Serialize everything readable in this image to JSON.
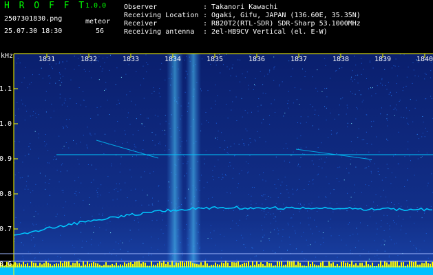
{
  "app": {
    "name": "H R O F F T",
    "version": "1.0.0"
  },
  "file": {
    "name": "2507301830.png",
    "datetime": "25.07.30 18:30"
  },
  "meteor": {
    "label": "meteor",
    "count": "56"
  },
  "info": [
    {
      "label": "Observer",
      "value": ": Takanori Kawachi"
    },
    {
      "label": "Receiving Location",
      "value": ": Ogaki, Gifu, JAPAN (136.60E, 35.35N)"
    },
    {
      "label": "Receiver",
      "value": ": R820T2(RTL-SDR) SDR-Sharp 53.1000MHz"
    },
    {
      "label": "Receiving antenna",
      "value": ": 2el-HB9CV Vertical (el. E-W)"
    }
  ],
  "plot": {
    "y_unit": "kHz",
    "y_ticks": [
      "1.1",
      "1.0",
      "0.9",
      "0.8",
      "0.7",
      "0.6"
    ],
    "x_ticks": [
      "1831",
      "1832",
      "1833",
      "1834",
      "1835",
      "1836",
      "1837",
      "1838",
      "1839",
      "1840"
    ],
    "colors": {
      "background": "#0a1f6e",
      "axis": "#ffff00",
      "label": "#ffffff",
      "trace": "#00c8ff",
      "bottom_bar": "#00bfff"
    }
  }
}
